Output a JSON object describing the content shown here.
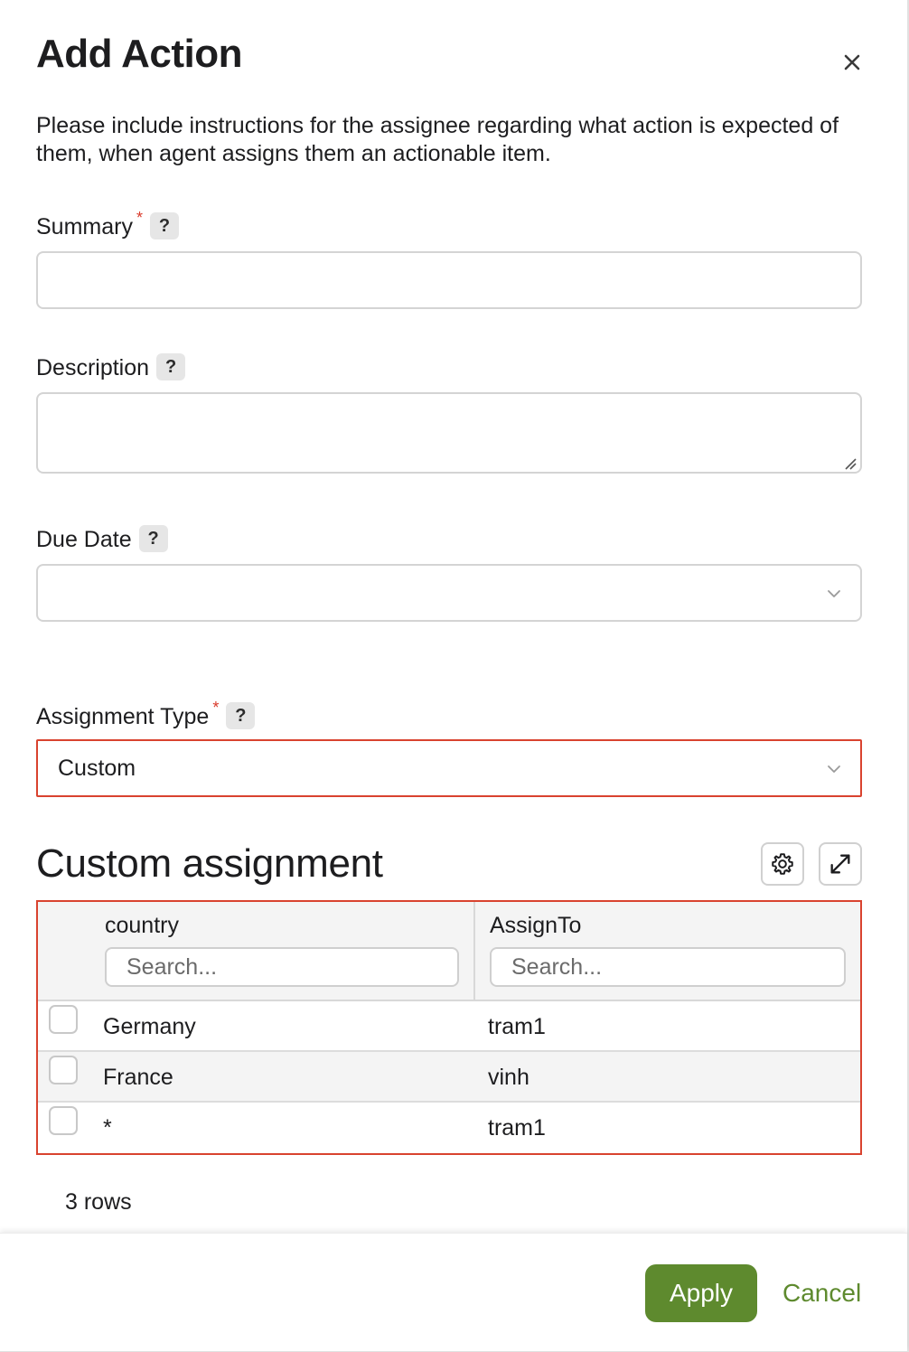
{
  "dialog": {
    "title": "Add Action",
    "intro": "Please include instructions for the assignee regarding what action is expected of them, when agent assigns them an actionable item."
  },
  "fields": {
    "summary": {
      "label": "Summary",
      "required_mark": "*",
      "help": "?",
      "value": ""
    },
    "description": {
      "label": "Description",
      "help": "?",
      "value": ""
    },
    "due_date": {
      "label": "Due Date",
      "help": "?",
      "value": ""
    },
    "assignment_type": {
      "label": "Assignment Type",
      "required_mark": "*",
      "help": "?",
      "value": "Custom"
    }
  },
  "custom_assignment": {
    "title": "Custom assignment",
    "columns": [
      {
        "title": "country",
        "search_placeholder": "Search..."
      },
      {
        "title": "AssignTo",
        "search_placeholder": "Search..."
      }
    ],
    "rows": [
      {
        "country": "Germany",
        "assign_to": "tram1"
      },
      {
        "country": "France",
        "assign_to": "vinh"
      },
      {
        "country": "*",
        "assign_to": "tram1"
      }
    ],
    "row_count": "3 rows"
  },
  "footer": {
    "apply_label": "Apply",
    "cancel_label": "Cancel"
  },
  "colors": {
    "accent": "#5e8a2e",
    "error_border": "#d9432f",
    "required": "#d93a2b"
  },
  "icons": [
    "close-icon",
    "chevron-down-icon",
    "gear-icon",
    "expand-icon",
    "resize-grip-icon"
  ]
}
